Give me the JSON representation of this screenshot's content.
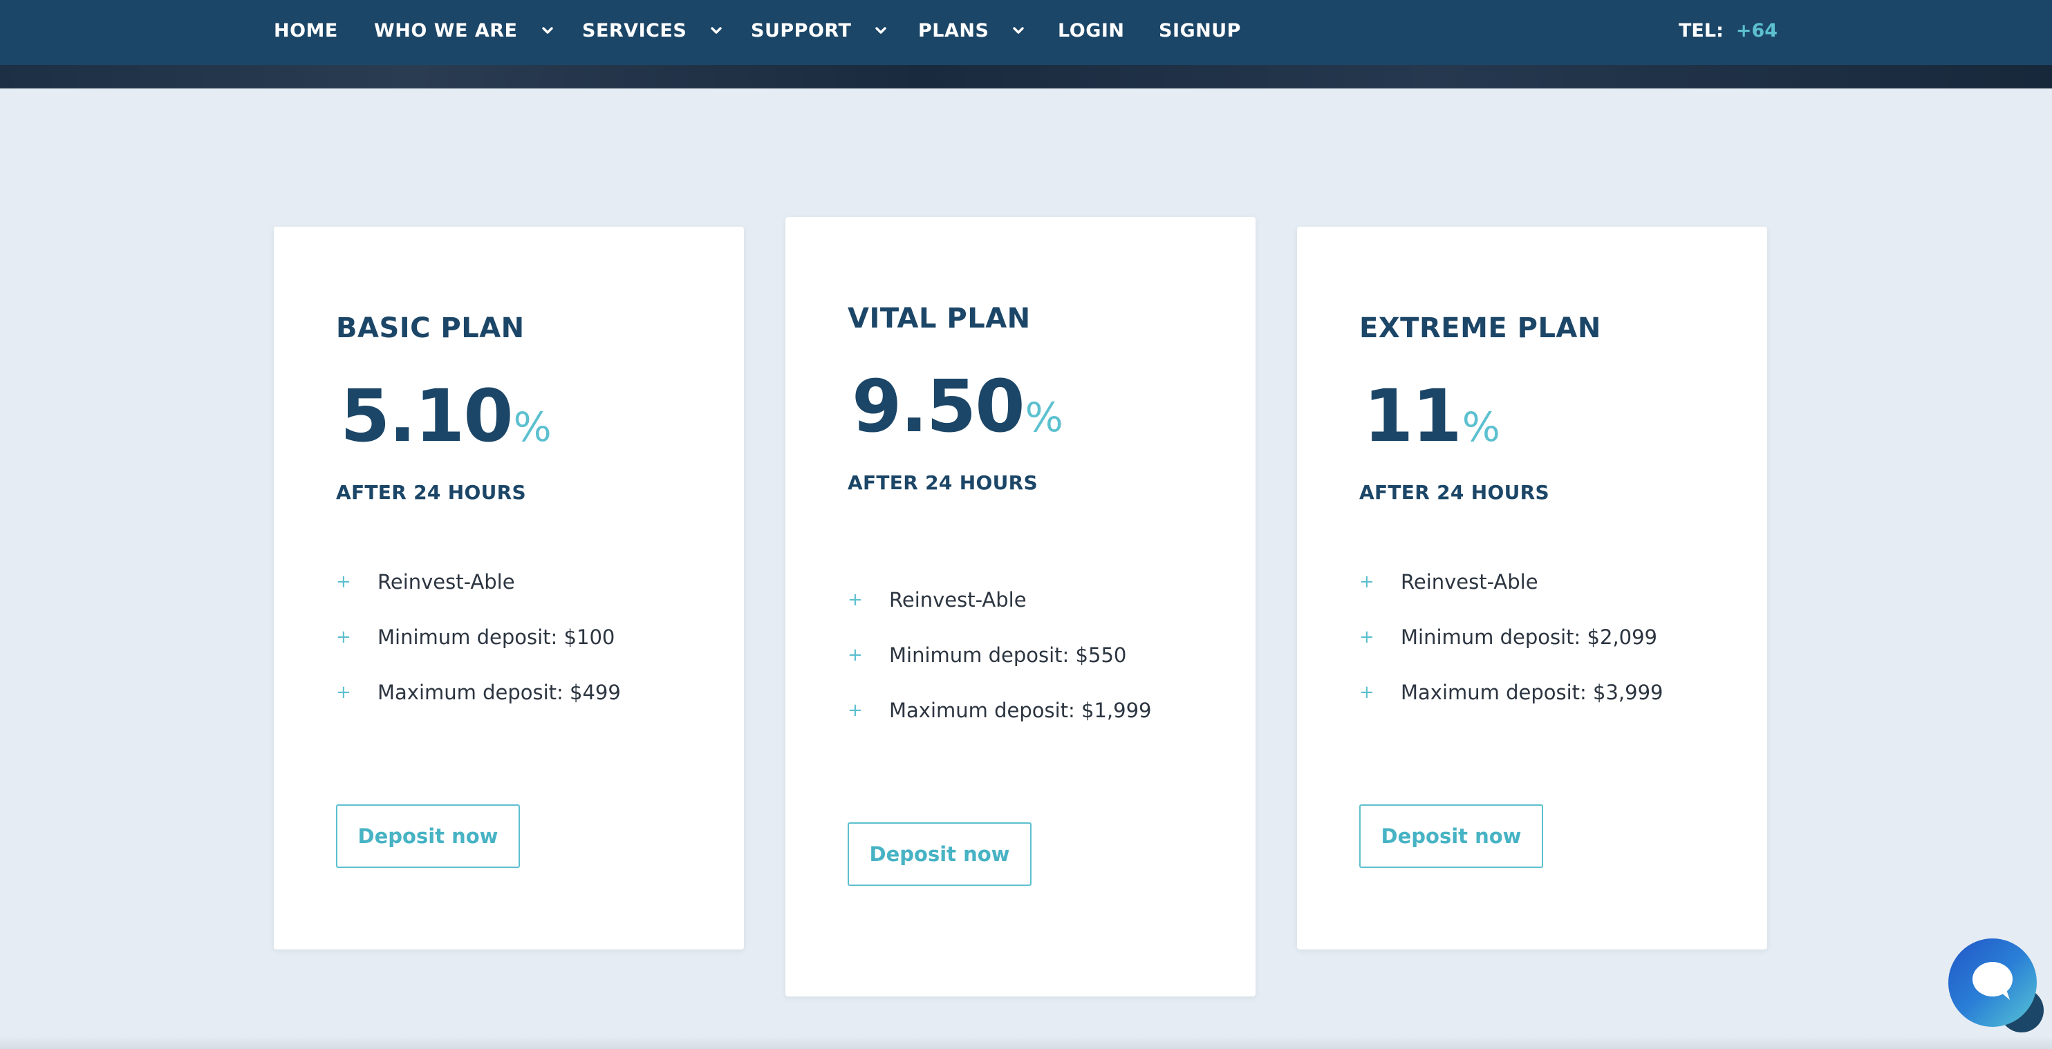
{
  "nav": {
    "items": [
      {
        "label": "HOME",
        "has_dropdown": false
      },
      {
        "label": "WHO WE ARE",
        "has_dropdown": true
      },
      {
        "label": "SERVICES",
        "has_dropdown": true
      },
      {
        "label": "SUPPORT",
        "has_dropdown": true
      },
      {
        "label": "PLANS",
        "has_dropdown": true
      },
      {
        "label": "LOGIN",
        "has_dropdown": false
      },
      {
        "label": "SIGNUP",
        "has_dropdown": false
      }
    ],
    "tel_label": "TEL:",
    "tel_number": "+64"
  },
  "plans": [
    {
      "title": "BASIC PLAN",
      "rate": "5.10",
      "rate_unit": "%",
      "period": "AFTER 24 HOURS",
      "features": [
        "Reinvest-Able",
        "Minimum deposit: $100",
        "Maximum deposit: $499"
      ],
      "button_label": "Deposit now"
    },
    {
      "title": "VITAL PLAN",
      "rate": "9.50",
      "rate_unit": "%",
      "period": "AFTER 24 HOURS",
      "features": [
        "Reinvest-Able",
        "Minimum deposit: $550",
        "Maximum deposit: $1,999"
      ],
      "button_label": "Deposit now"
    },
    {
      "title": "EXTREME PLAN",
      "rate": "11",
      "rate_unit": "%",
      "period": "AFTER 24 HOURS",
      "features": [
        "Reinvest-Able",
        "Minimum deposit: $2,099",
        "Maximum deposit: $3,999"
      ],
      "button_label": "Deposit now"
    }
  ],
  "feature_bullet": "+",
  "icons": {
    "nav_dropdown": "chevron-down-icon",
    "chat": "chat-bubble-icon"
  },
  "colors": {
    "nav_background": "#1c4667",
    "accent": "#5cc0cf",
    "page_background": "#e5ecf3",
    "heading": "#1c4667"
  }
}
